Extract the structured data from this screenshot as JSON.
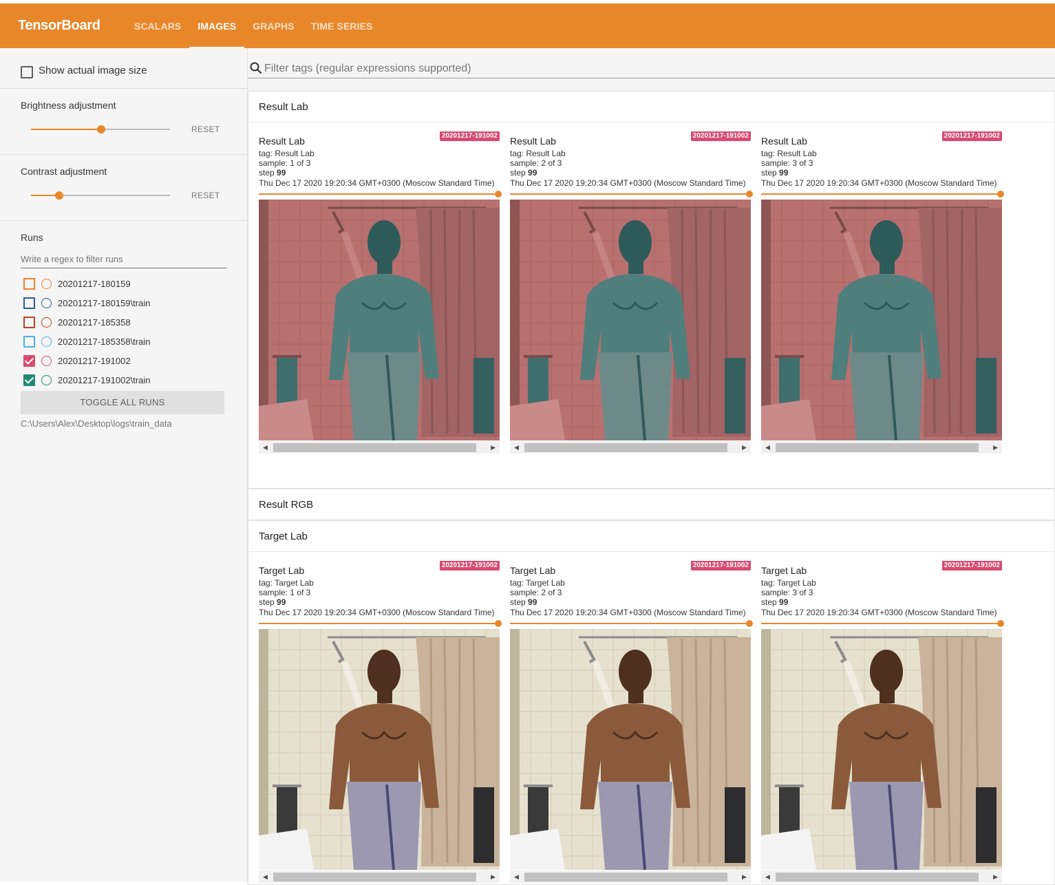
{
  "app": {
    "title": "TensorBoard"
  },
  "tabs": [
    {
      "label": "SCALARS",
      "active": false
    },
    {
      "label": "IMAGES",
      "active": true
    },
    {
      "label": "GRAPHS",
      "active": false
    },
    {
      "label": "TIME SERIES",
      "active": false
    }
  ],
  "sidebar": {
    "show_actual_size_label": "Show actual image size",
    "show_actual_size_checked": false,
    "brightness": {
      "title": "Brightness adjustment",
      "value": 0.5,
      "reset_label": "RESET"
    },
    "contrast": {
      "title": "Contrast adjustment",
      "value": 0.2,
      "reset_label": "RESET"
    },
    "runs_title": "Runs",
    "runs_filter_placeholder": "Write a regex to filter runs",
    "runs": [
      {
        "name": "20201217-180159",
        "checked": false,
        "color": "#f27d2e"
      },
      {
        "name": "20201217-180159\\train",
        "checked": false,
        "color": "#2c5b9c"
      },
      {
        "name": "20201217-185358",
        "checked": false,
        "color": "#c0401a"
      },
      {
        "name": "20201217-185358\\train",
        "checked": false,
        "color": "#4cb0e6"
      },
      {
        "name": "20201217-191002",
        "checked": true,
        "color": "#d84a72"
      },
      {
        "name": "20201217-191002\\train",
        "checked": true,
        "color": "#218a73"
      }
    ],
    "toggle_all_label": "TOGGLE ALL RUNS",
    "logdir": "C:\\Users\\Alex\\Desktop\\logs\\train_data"
  },
  "main": {
    "filter_placeholder": "Filter tags (regular expressions supported)",
    "groups": [
      {
        "name": "Result Lab",
        "cards": [
          {
            "title": "Result Lab",
            "run": "20201217-191002",
            "tag": "tag: Result Lab",
            "sample": "sample: 1 of 3",
            "step_label": "step",
            "step": "99",
            "time": "Thu Dec 17 2020 19:20:34 GMT+0300 (Moscow Standard Time)"
          },
          {
            "title": "Result Lab",
            "run": "20201217-191002",
            "tag": "tag: Result Lab",
            "sample": "sample: 2 of 3",
            "step_label": "step",
            "step": "99",
            "time": "Thu Dec 17 2020 19:20:34 GMT+0300 (Moscow Standard Time)"
          },
          {
            "title": "Result Lab",
            "run": "20201217-191002",
            "tag": "tag: Result Lab",
            "sample": "sample: 3 of 3",
            "step_label": "step",
            "step": "99",
            "time": "Thu Dec 17 2020 19:20:34 GMT+0300 (Moscow Standard Time)"
          }
        ]
      },
      {
        "name": "Result RGB",
        "cards": []
      },
      {
        "name": "Target Lab",
        "cards": [
          {
            "title": "Target Lab",
            "run": "20201217-191002",
            "tag": "tag: Target Lab",
            "sample": "sample: 1 of 3",
            "step_label": "step",
            "step": "99",
            "time": "Thu Dec 17 2020 19:20:34 GMT+0300 (Moscow Standard Time)"
          },
          {
            "title": "Target Lab",
            "run": "20201217-191002",
            "tag": "tag: Target Lab",
            "sample": "sample: 2 of 3",
            "step_label": "step",
            "step": "99",
            "time": "Thu Dec 17 2020 19:20:34 GMT+0300 (Moscow Standard Time)"
          },
          {
            "title": "Target Lab",
            "run": "20201217-191002",
            "tag": "tag: Target Lab",
            "sample": "sample: 3 of 3",
            "step_label": "step",
            "step": "99",
            "time": "Thu Dec 17 2020 19:20:34 GMT+0300 (Moscow Standard Time)"
          }
        ]
      }
    ]
  },
  "colors": {
    "accent": "#e8872a",
    "run_badge": "#d84a72"
  }
}
